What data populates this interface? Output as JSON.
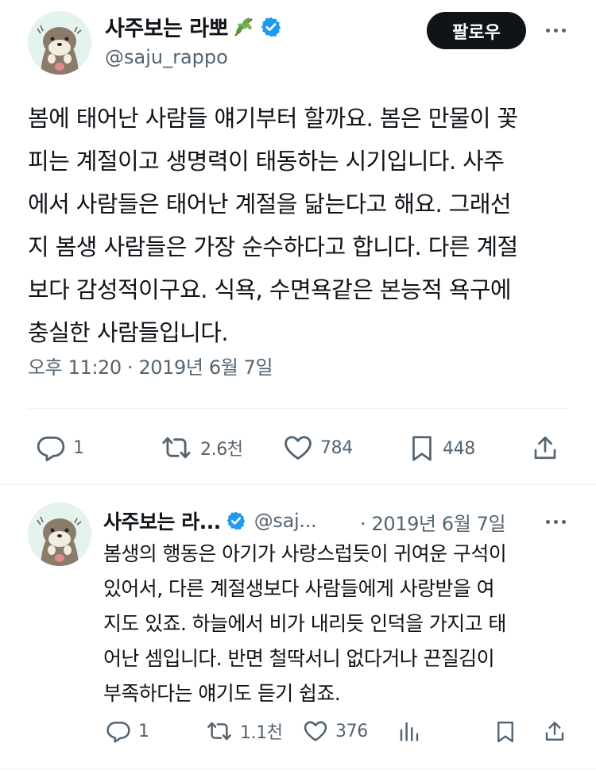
{
  "tweet": {
    "display_name": "사주보는 라뽀",
    "handle": "@saju_rappo",
    "follow_label": "팔로우",
    "text_lines": [
      "봄에 태어난 사람들 얘기부터 할까요. 봄은 만물이 꽃",
      "피는 계절이고 생명력이 태동하는 시기입니다. 사주",
      "에서 사람들은 태어난 계절을 닮는다고 해요. 그래선",
      "지 봄생 사람들은 가장 순수하다고 합니다. 다른 계절",
      "보다 감성적이구요. 식욕, 수면욕같은 본능적 욕구에",
      "충실한 사람들입니다."
    ],
    "timestamp": "오후 11:20 · 2019년 6월 7일",
    "replies": "1",
    "retweets": "2.6천",
    "likes": "784",
    "bookmarks": "448"
  },
  "reply": {
    "display_name": "사주보는 라...",
    "handle": "@saj...",
    "date": "· 2019년 6월 7일",
    "text_lines": [
      "봄생의 행동은 아기가 사랑스럽듯이 귀여운 구석이",
      "있어서, 다른 계절생보다 사람들에게 사랑받을 여",
      "지도 있죠. 하늘에서 비가 내리듯 인덕을 가지고 태",
      "어난 셈입니다. 반면 철딱서니 없다거나 끈질김이",
      "부족하다는 얘기도 듣기 쉽죠."
    ],
    "replies": "1",
    "retweets": "1.1천",
    "likes": "376"
  },
  "colors": {
    "text": "#0f1419",
    "secondary": "#536471",
    "verified": "#1d9bf0",
    "divider": "#eff3f4",
    "avatar_bg": "#e4f3ec"
  },
  "icons": [
    "verified-badge-icon",
    "leaf-emoji-icon",
    "reply-icon",
    "retweet-icon",
    "like-icon",
    "bookmark-icon",
    "share-icon",
    "views-icon",
    "more-icon"
  ]
}
